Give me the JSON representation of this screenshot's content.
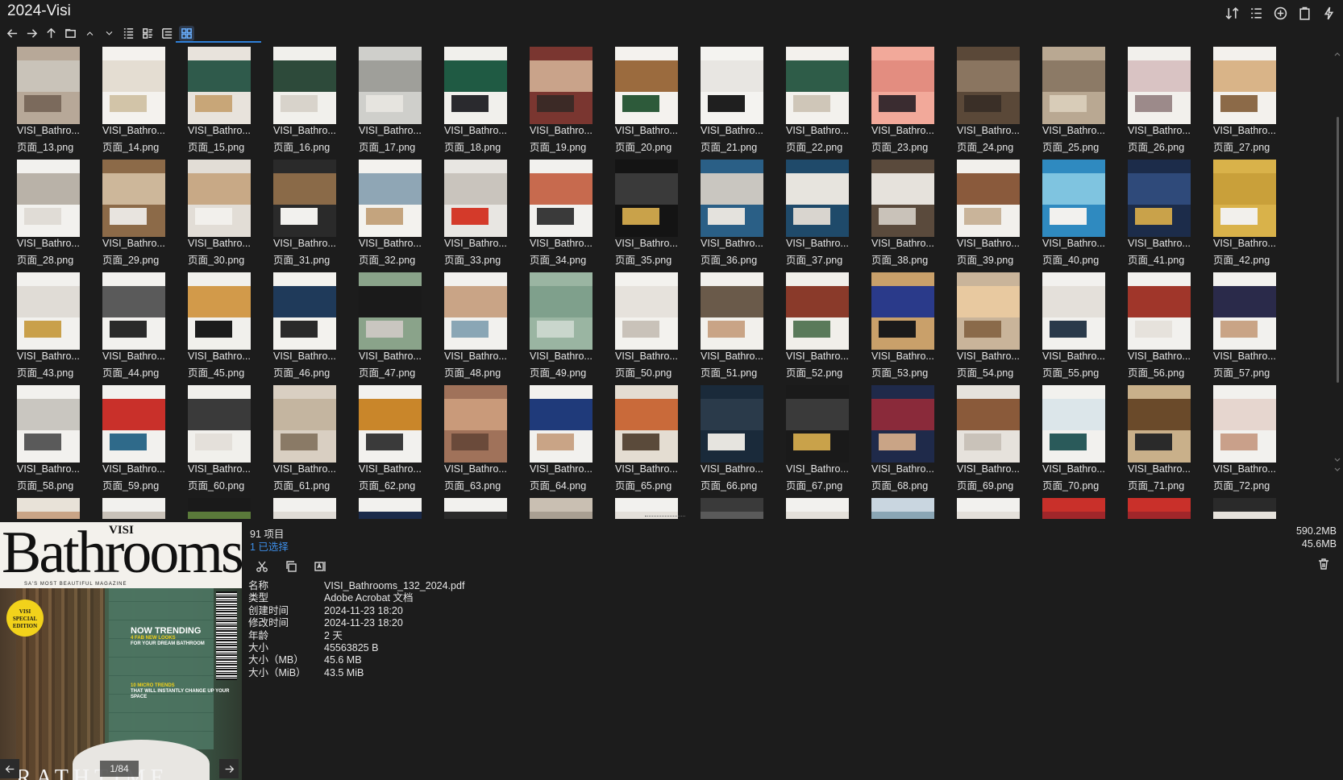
{
  "window": {
    "title": "2024-Visi"
  },
  "toolbar": {
    "icons": [
      "back-arrow-icon",
      "forward-arrow-icon",
      "up-arrow-icon",
      "folder-icon",
      "chevron-up-icon",
      "chevron-down-icon",
      "list-view-icon",
      "details-view-icon",
      "tree-view-icon",
      "thumbnail-view-icon"
    ]
  },
  "top_right_icons": [
    "sort-icon",
    "list-options-icon",
    "add-circle-icon",
    "clipboard-icon",
    "lightning-icon"
  ],
  "thumbnails": [
    {
      "line1": "VISI_Bathro...",
      "line2": "页面_13.png",
      "colors": [
        "#b7a898",
        "#c9c3b9",
        "#7b6a5c"
      ]
    },
    {
      "line1": "VISI_Bathro...",
      "line2": "页面_14.png",
      "colors": [
        "#f4f2ee",
        "#e4ddd2",
        "#d2c4a8"
      ]
    },
    {
      "line1": "VISI_Bathro...",
      "line2": "页面_15.png",
      "colors": [
        "#e8e3dc",
        "#2f5a4b",
        "#c8a678"
      ]
    },
    {
      "line1": "VISI_Bathro...",
      "line2": "页面_16.png",
      "colors": [
        "#f1f0ec",
        "#2d4a3a",
        "#d8d3cb"
      ]
    },
    {
      "line1": "VISI_Bathro...",
      "line2": "页面_17.png",
      "colors": [
        "#cfcfcb",
        "#9f9f9a",
        "#e6e4df"
      ]
    },
    {
      "line1": "VISI_Bathro...",
      "line2": "页面_18.png",
      "colors": [
        "#f1f0ec",
        "#1f5a43",
        "#2a2a2e"
      ]
    },
    {
      "line1": "VISI_Bathro...",
      "line2": "页面_19.png",
      "colors": [
        "#7a3630",
        "#c9a38a",
        "#3c2a26"
      ]
    },
    {
      "line1": "VISI_Bathro...",
      "line2": "页面_20.png",
      "colors": [
        "#f4f2ee",
        "#9b6b3e",
        "#2d5a3a"
      ]
    },
    {
      "line1": "VISI_Bathro...",
      "line2": "页面_21.png",
      "colors": [
        "#f4f3f0",
        "#e8e6e2",
        "#1f1f1f"
      ]
    },
    {
      "line1": "VISI_Bathro...",
      "line2": "页面_22.png",
      "colors": [
        "#f3f1ed",
        "#2e5c48",
        "#cfc6b8"
      ]
    },
    {
      "line1": "VISI_Bathro...",
      "line2": "页面_23.png",
      "colors": [
        "#f2a99a",
        "#e38d80",
        "#3a2c30"
      ]
    },
    {
      "line1": "VISI_Bathro...",
      "line2": "页面_24.png",
      "colors": [
        "#5a4838",
        "#8a7560",
        "#3a2f27"
      ]
    },
    {
      "line1": "VISI_Bathro...",
      "line2": "页面_25.png",
      "colors": [
        "#b9a892",
        "#8c7a66",
        "#d8ccb8"
      ]
    },
    {
      "line1": "VISI_Bathro...",
      "line2": "页面_26.png",
      "colors": [
        "#f2f0ec",
        "#d9c3c3",
        "#9c8a8a"
      ]
    },
    {
      "line1": "VISI_Bathro...",
      "line2": "页面_27.png",
      "colors": [
        "#f3f1ed",
        "#d9b488",
        "#8c6a48"
      ]
    },
    {
      "line1": "VISI_Bathro...",
      "line2": "页面_28.png",
      "colors": [
        "#f2f1ee",
        "#b9b2a8",
        "#e0dcd6"
      ]
    },
    {
      "line1": "VISI_Bathro...",
      "line2": "页面_29.png",
      "colors": [
        "#8c6a48",
        "#cdb79a",
        "#e8e4df"
      ]
    },
    {
      "line1": "VISI_Bathro...",
      "line2": "页面_30.png",
      "colors": [
        "#e2ddd6",
        "#c8a986",
        "#f2f0ec"
      ]
    },
    {
      "line1": "VISI_Bathro...",
      "line2": "页面_31.png",
      "colors": [
        "#2a2a2a",
        "#8a6a48",
        "#f2f1ee"
      ]
    },
    {
      "line1": "VISI_Bathro...",
      "line2": "页面_32.png",
      "colors": [
        "#f3f2ee",
        "#8fa6b5",
        "#c4a47e"
      ]
    },
    {
      "line1": "VISI_Bathro...",
      "line2": "页面_33.png",
      "colors": [
        "#e8e6e2",
        "#c9c4bd",
        "#d43a2a"
      ]
    },
    {
      "line1": "VISI_Bathro...",
      "line2": "页面_34.png",
      "colors": [
        "#f2f1ee",
        "#c76a4e",
        "#3a3a3a"
      ]
    },
    {
      "line1": "VISI_Bathro...",
      "line2": "页面_35.png",
      "colors": [
        "#141414",
        "#3a3a3a",
        "#c9a24a"
      ]
    },
    {
      "line1": "VISI_Bathro...",
      "line2": "页面_36.png",
      "colors": [
        "#2a5f86",
        "#c9c6c0",
        "#e4e2dd"
      ]
    },
    {
      "line1": "VISI_Bathro...",
      "line2": "页面_37.png",
      "colors": [
        "#1f4a6a",
        "#e7e4de",
        "#d9d5cf"
      ]
    },
    {
      "line1": "VISI_Bathro...",
      "line2": "页面_38.png",
      "colors": [
        "#5a4a3c",
        "#e6e2dc",
        "#c9c2b9"
      ]
    },
    {
      "line1": "VISI_Bathro...",
      "line2": "页面_39.png",
      "colors": [
        "#f2f0ec",
        "#8a5a3c",
        "#c9b49a"
      ]
    },
    {
      "line1": "VISI_Bathro...",
      "line2": "页面_40.png",
      "colors": [
        "#2f8ac0",
        "#7fc4e0",
        "#f2f1ee"
      ]
    },
    {
      "line1": "VISI_Bathro...",
      "line2": "页面_41.png",
      "colors": [
        "#1c2c4a",
        "#2f4a7a",
        "#c9a24a"
      ]
    },
    {
      "line1": "VISI_Bathro...",
      "line2": "页面_42.png",
      "colors": [
        "#d9b24a",
        "#c9a03a",
        "#f2f0ec"
      ]
    },
    {
      "line1": "VISI_Bathro...",
      "line2": "页面_43.png",
      "colors": [
        "#f2f1ee",
        "#e0dcd6",
        "#c9a04a"
      ]
    },
    {
      "line1": "VISI_Bathro...",
      "line2": "页面_44.png",
      "colors": [
        "#f2f1ee",
        "#5a5a5a",
        "#2a2a2a"
      ]
    },
    {
      "line1": "VISI_Bathro...",
      "line2": "页面_45.png",
      "colors": [
        "#f1f0ec",
        "#d29a4a",
        "#1c1c1c"
      ]
    },
    {
      "line1": "VISI_Bathro...",
      "line2": "页面_46.png",
      "colors": [
        "#f3f2ee",
        "#1f3a5a",
        "#2a2a2a"
      ]
    },
    {
      "line1": "VISI_Bathro...",
      "line2": "页面_47.png",
      "colors": [
        "#8aa38a",
        "#1a1a1a",
        "#c9c6c0"
      ]
    },
    {
      "line1": "VISI_Bathro...",
      "line2": "页面_48.png",
      "colors": [
        "#f2f1ee",
        "#c9a486",
        "#8aa6b5"
      ]
    },
    {
      "line1": "VISI_Bathro...",
      "line2": "页面_49.png",
      "colors": [
        "#9ab5a2",
        "#7fa08c",
        "#c9d6cc"
      ]
    },
    {
      "line1": "VISI_Bathro...",
      "line2": "页面_50.png",
      "colors": [
        "#f3f2ee",
        "#e6e2dc",
        "#c9c2b9"
      ]
    },
    {
      "line1": "VISI_Bathro...",
      "line2": "页面_51.png",
      "colors": [
        "#f2f0ec",
        "#6a5a4a",
        "#c9a486"
      ]
    },
    {
      "line1": "VISI_Bathro...",
      "line2": "页面_52.png",
      "colors": [
        "#f1efea",
        "#8a3a2a",
        "#5a7a5a"
      ]
    },
    {
      "line1": "VISI_Bathro...",
      "line2": "页面_53.png",
      "colors": [
        "#c9a06a",
        "#2a3a8a",
        "#1a1a1a"
      ]
    },
    {
      "line1": "VISI_Bathro...",
      "line2": "页面_54.png",
      "colors": [
        "#c9b49a",
        "#e8c9a0",
        "#8a6a4a"
      ]
    },
    {
      "line1": "VISI_Bathro...",
      "line2": "页面_55.png",
      "colors": [
        "#f2f1ee",
        "#e4e0da",
        "#2a3a4a"
      ]
    },
    {
      "line1": "VISI_Bathro...",
      "line2": "页面_56.png",
      "colors": [
        "#f2f1ee",
        "#a0362a",
        "#e6e2dc"
      ]
    },
    {
      "line1": "VISI_Bathro...",
      "line2": "页面_57.png",
      "colors": [
        "#f2f1ee",
        "#2a2a4a",
        "#c9a486"
      ]
    },
    {
      "line1": "VISI_Bathro...",
      "line2": "页面_58.png",
      "colors": [
        "#f2f1ee",
        "#c9c6c0",
        "#5a5a5a"
      ]
    },
    {
      "line1": "VISI_Bathro...",
      "line2": "页面_59.png",
      "colors": [
        "#f2f1ee",
        "#c9302a",
        "#2f6a8a"
      ]
    },
    {
      "line1": "VISI_Bathro...",
      "line2": "页面_60.png",
      "colors": [
        "#f1f0ec",
        "#3a3a3a",
        "#e4e0da"
      ]
    },
    {
      "line1": "VISI_Bathro...",
      "line2": "页面_61.png",
      "colors": [
        "#d9cfc2",
        "#c4b5a0",
        "#8a7a66"
      ]
    },
    {
      "line1": "VISI_Bathro...",
      "line2": "页面_62.png",
      "colors": [
        "#f2f1ee",
        "#c9862a",
        "#3a3a3a"
      ]
    },
    {
      "line1": "VISI_Bathro...",
      "line2": "页面_63.png",
      "colors": [
        "#a0725a",
        "#c99a7a",
        "#6a4a3a"
      ]
    },
    {
      "line1": "VISI_Bathro...",
      "line2": "页面_64.png",
      "colors": [
        "#f2f1ee",
        "#1f3a7a",
        "#c9a486"
      ]
    },
    {
      "line1": "VISI_Bathro...",
      "line2": "页面_65.png",
      "colors": [
        "#e4ddd2",
        "#c96a3a",
        "#5a4a3a"
      ]
    },
    {
      "line1": "VISI_Bathro...",
      "line2": "页面_66.png",
      "colors": [
        "#1a2a3a",
        "#2a3a4a",
        "#e6e4df"
      ]
    },
    {
      "line1": "VISI_Bathro...",
      "line2": "页面_67.png",
      "colors": [
        "#1a1a1a",
        "#3a3a3a",
        "#c9a24a"
      ]
    },
    {
      "line1": "VISI_Bathro...",
      "line2": "页面_68.png",
      "colors": [
        "#1f2a4a",
        "#8a2a3a",
        "#c9a486"
      ]
    },
    {
      "line1": "VISI_Bathro...",
      "line2": "页面_69.png",
      "colors": [
        "#e6e2dc",
        "#8a5a3a",
        "#c9c2b9"
      ]
    },
    {
      "line1": "VISI_Bathro...",
      "line2": "页面_70.png",
      "colors": [
        "#f2f1ee",
        "#dce6ea",
        "#2a5a5a"
      ]
    },
    {
      "line1": "VISI_Bathro...",
      "line2": "页面_71.png",
      "colors": [
        "#c9b08a",
        "#6a4a2a",
        "#2a2a2a"
      ]
    },
    {
      "line1": "VISI_Bathro...",
      "line2": "页面_72.png",
      "colors": [
        "#f2f1ee",
        "#e6d6cf",
        "#c9a08a"
      ]
    },
    {
      "line1": "",
      "line2": "",
      "colors": [
        "#e8e2d8",
        "#c9a486",
        "#8a6a4a"
      ]
    },
    {
      "line1": "",
      "line2": "",
      "colors": [
        "#f2f1ee",
        "#c9c2b9",
        "#e6e2dc"
      ]
    },
    {
      "line1": "",
      "line2": "",
      "colors": [
        "#1a1a1a",
        "#5a7a3a",
        "#e6e2dc"
      ]
    },
    {
      "line1": "",
      "line2": "",
      "colors": [
        "#f2f1ee",
        "#e0dcd6",
        "#c9c6c0"
      ]
    },
    {
      "line1": "",
      "line2": "",
      "colors": [
        "#f2f1ee",
        "#1a2a4a",
        "#c9c6c0"
      ]
    },
    {
      "line1": "",
      "line2": "",
      "colors": [
        "#f2f1ee",
        "#2a2a2a",
        "#c9c2b9"
      ]
    },
    {
      "line1": "",
      "line2": "",
      "colors": [
        "#c9bfb2",
        "#a99f92",
        "#e6e2dc"
      ]
    },
    {
      "line1": "",
      "line2": "",
      "colors": [
        "#f2f1ee",
        "#e4e0da",
        "#c9c6c0"
      ]
    },
    {
      "line1": "",
      "line2": "",
      "colors": [
        "#3a3a3a",
        "#5a5a5a",
        "#8a8a8a"
      ]
    },
    {
      "line1": "",
      "line2": "",
      "colors": [
        "#f2f1ee",
        "#e4e0da",
        "#c9c6c0"
      ]
    },
    {
      "line1": "",
      "line2": "",
      "colors": [
        "#c9d6e0",
        "#8aa6b5",
        "#2f6a8a"
      ]
    },
    {
      "line1": "",
      "line2": "",
      "colors": [
        "#f2f1ee",
        "#e4e0da",
        "#c9c6c0"
      ]
    },
    {
      "line1": "",
      "line2": "",
      "colors": [
        "#c9302a",
        "#a0262a",
        "#e6e2dc"
      ]
    },
    {
      "line1": "",
      "line2": "",
      "colors": [
        "#c9302a",
        "#a0262a",
        "#e6e2dc"
      ]
    },
    {
      "line1": "",
      "line2": "",
      "colors": [
        "#2a2a2a",
        "#e6e2dc",
        "#c9c6c0"
      ]
    }
  ],
  "status": {
    "item_count": "91 项目",
    "selected_count": "1 已选择",
    "total_size": "590.2MB",
    "selected_size": "45.6MB"
  },
  "actions": {
    "icons": [
      "cut-icon",
      "copy-icon",
      "rename-icon",
      "delete-icon"
    ]
  },
  "properties": [
    {
      "key": "名称",
      "value": "VISI_Bathrooms_132_2024.pdf"
    },
    {
      "key": "类型",
      "value": "Adobe Acrobat 文档"
    },
    {
      "key": "创建时间",
      "value": "2024-11-23  18:20"
    },
    {
      "key": "修改时间",
      "value": "2024-11-23  18:20"
    },
    {
      "key": "年龄",
      "value": "2 天"
    },
    {
      "key": "大小",
      "value": "45563825 B"
    },
    {
      "key": "大小（MB）",
      "value": "45.6 MB"
    },
    {
      "key": "大小（MiB）",
      "value": "43.5 MiB"
    }
  ],
  "preview": {
    "cover_title": "Bathrooms",
    "cover_brand": "VISI",
    "cover_tagline": "SA'S MOST BEAUTIFUL MAGAZINE",
    "badge": "VISI SPECIAL EDITION",
    "headline": "NOW TRENDING",
    "headline_sub1": "4 FAB NEW LOOKS",
    "headline_sub2": "FOR YOUR DREAM BATHROOM",
    "micro_1": "10 MICRO TRENDS",
    "micro_2": "THAT WILL INSTANTLY CHANGE UP YOUR SPACE",
    "bottom_text": "RATHTIME",
    "page_indicator": "1/84"
  }
}
